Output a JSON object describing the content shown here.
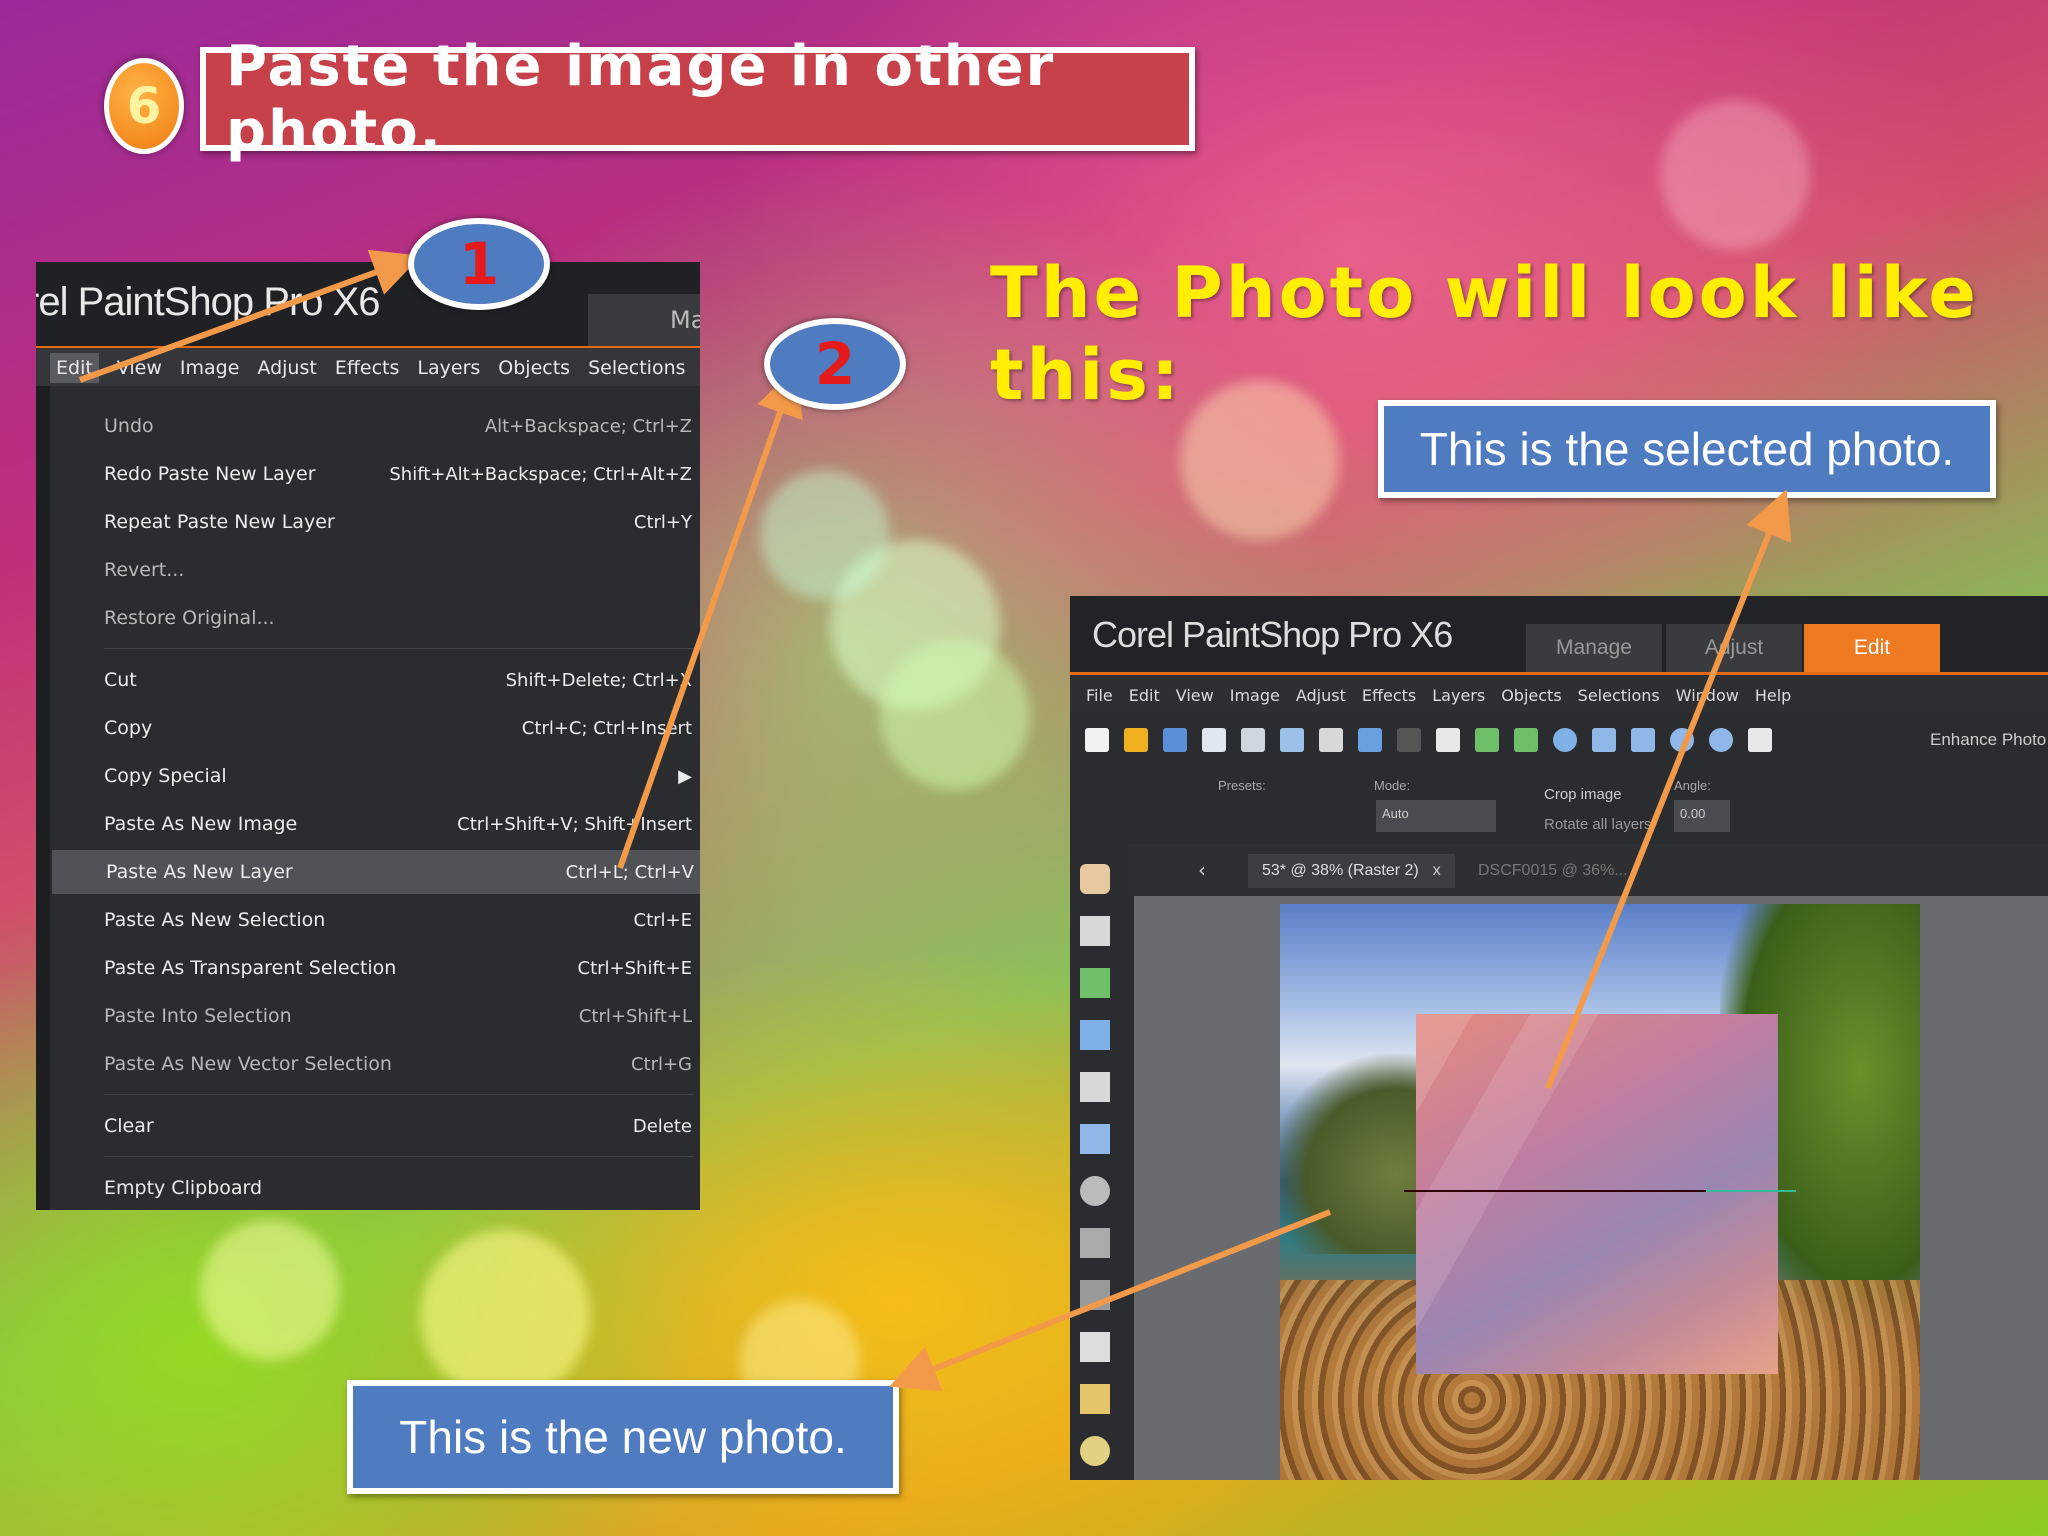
{
  "slide": {
    "step_number": "6",
    "title": "Paste the image in other photo.",
    "headline": "The Photo will look like this:",
    "callout_selected": "This is the selected photo.",
    "callout_new": "This is the new photo.",
    "marker_1": "1",
    "marker_2": "2",
    "colors": {
      "title_box": "#c6414a",
      "callout": "#4f7bc0",
      "headline": "#ffee00",
      "arrow": "#f29a4a",
      "marker_number": "#e51b1b"
    }
  },
  "menu_screenshot": {
    "app_title": "rel PaintShop Pro X6",
    "manage_tab": "Manag",
    "menubar": [
      "Edit",
      "View",
      "Image",
      "Adjust",
      "Effects",
      "Layers",
      "Objects",
      "Selections"
    ],
    "items": [
      {
        "label": "Undo",
        "shortcut": "Alt+Backspace; Ctrl+Z",
        "dim": true
      },
      {
        "label": "Redo  Paste New Layer",
        "shortcut": "Shift+Alt+Backspace; Ctrl+Alt+Z",
        "dim": false
      },
      {
        "label": "Repeat  Paste New Layer",
        "shortcut": "Ctrl+Y",
        "dim": false
      },
      {
        "label": "Revert...",
        "shortcut": "",
        "dim": true
      },
      {
        "label": "Restore Original...",
        "shortcut": "",
        "dim": true
      },
      {
        "label": "Cut",
        "shortcut": "Shift+Delete; Ctrl+X",
        "dim": false
      },
      {
        "label": "Copy",
        "shortcut": "Ctrl+C; Ctrl+Insert",
        "dim": false
      },
      {
        "label": "Copy Special",
        "shortcut": "▶",
        "dim": false
      },
      {
        "label": "Paste As New Image",
        "shortcut": "Ctrl+Shift+V; Shift+Insert",
        "dim": false
      },
      {
        "label": "Paste As New Layer",
        "shortcut": "Ctrl+L; Ctrl+V",
        "dim": false,
        "highlighted": true
      },
      {
        "label": "Paste As New Selection",
        "shortcut": "Ctrl+E",
        "dim": false
      },
      {
        "label": "Paste As Transparent Selection",
        "shortcut": "Ctrl+Shift+E",
        "dim": false
      },
      {
        "label": "Paste Into Selection",
        "shortcut": "Ctrl+Shift+L",
        "dim": true
      },
      {
        "label": "Paste As New Vector Selection",
        "shortcut": "Ctrl+G",
        "dim": true
      },
      {
        "label": "Clear",
        "shortcut": "Delete",
        "dim": false
      },
      {
        "label": "Empty Clipboard",
        "shortcut": "",
        "dim": false
      }
    ]
  },
  "app_screenshot": {
    "app_title": "Corel PaintShop Pro X6",
    "tabs": [
      "Manage",
      "Adjust",
      "Edit"
    ],
    "active_tab": "Edit",
    "menubar": [
      "File",
      "Edit",
      "View",
      "Image",
      "Adjust",
      "Effects",
      "Layers",
      "Objects",
      "Selections",
      "Window",
      "Help"
    ],
    "enhance_photo": "Enhance Photo",
    "options": {
      "presets_label": "Presets:",
      "mode_label": "Mode:",
      "mode_value": "Auto",
      "crop_image": "Crop image",
      "rotate_all_layers": "Rotate all layers",
      "angle_label": "Angle:",
      "angle_value": "0.00"
    },
    "doc_tab": "53* @ 38% (Raster 2)",
    "doc_tab_close": "x",
    "doc_tab_2": "DSCF0015 @ 36%..."
  }
}
